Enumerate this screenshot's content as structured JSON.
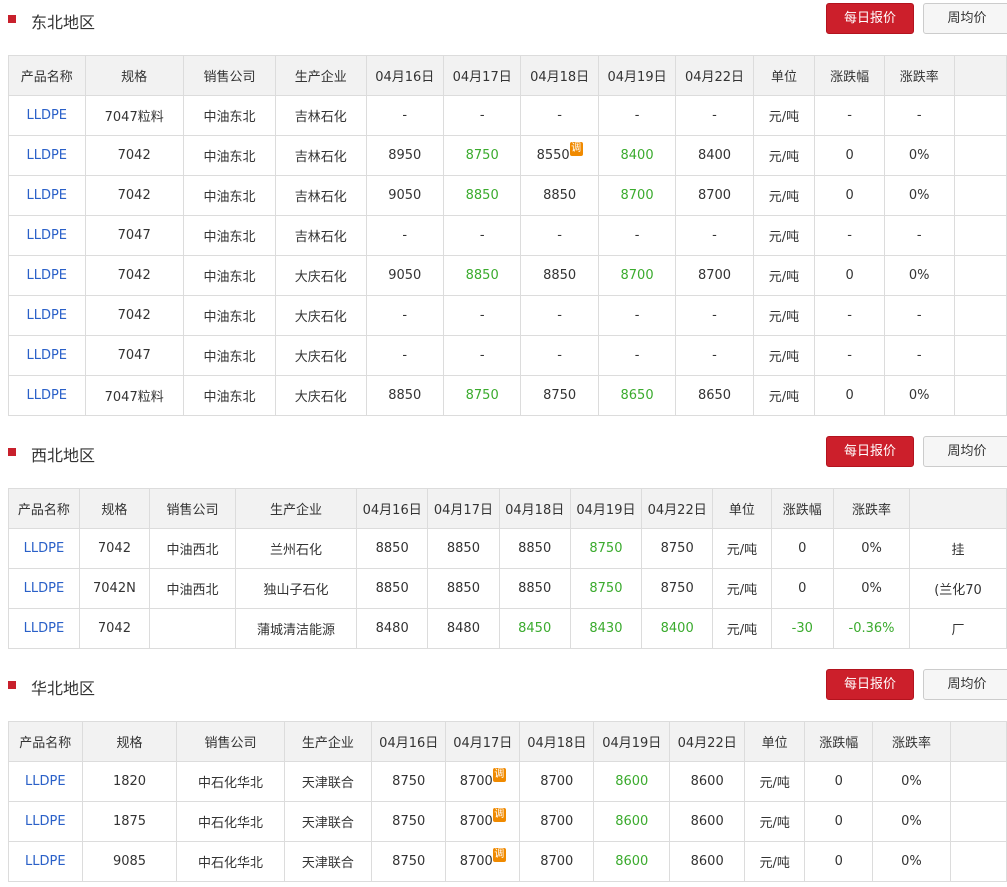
{
  "buttons": {
    "daily": "每日报价",
    "weekly": "周均价"
  },
  "adjust_badge": "调",
  "sections": [
    {
      "title": "东北地区",
      "headers": [
        "产品名称",
        "规格",
        "销售公司",
        "生产企业",
        "04月16日",
        "04月17日",
        "04月18日",
        "04月19日",
        "04月22日",
        "单位",
        "涨跌幅",
        "涨跌率",
        ""
      ],
      "rows": [
        [
          "LLDPE",
          "7047粒料",
          "中油东北",
          "吉林石化",
          "-",
          "-",
          "-",
          "-",
          "-",
          "元/吨",
          "-",
          "-",
          ""
        ],
        [
          "LLDPE",
          "7042",
          "中油东北",
          "吉林石化",
          "8950",
          "8750",
          "8550",
          "8400",
          "8400",
          "元/吨",
          "0",
          "0%",
          ""
        ],
        [
          "LLDPE",
          "7042",
          "中油东北",
          "吉林石化",
          "9050",
          "8850",
          "8850",
          "8700",
          "8700",
          "元/吨",
          "0",
          "0%",
          ""
        ],
        [
          "LLDPE",
          "7047",
          "中油东北",
          "吉林石化",
          "-",
          "-",
          "-",
          "-",
          "-",
          "元/吨",
          "-",
          "-",
          ""
        ],
        [
          "LLDPE",
          "7042",
          "中油东北",
          "大庆石化",
          "9050",
          "8850",
          "8850",
          "8700",
          "8700",
          "元/吨",
          "0",
          "0%",
          ""
        ],
        [
          "LLDPE",
          "7042",
          "中油东北",
          "大庆石化",
          "-",
          "-",
          "-",
          "-",
          "-",
          "元/吨",
          "-",
          "-",
          ""
        ],
        [
          "LLDPE",
          "7047",
          "中油东北",
          "大庆石化",
          "-",
          "-",
          "-",
          "-",
          "-",
          "元/吨",
          "-",
          "-",
          ""
        ],
        [
          "LLDPE",
          "7047粒料",
          "中油东北",
          "大庆石化",
          "8850",
          "8750",
          "8750",
          "8650",
          "8650",
          "元/吨",
          "0",
          "0%",
          ""
        ]
      ],
      "green": [
        [
          1,
          5
        ],
        [
          1,
          7
        ],
        [
          2,
          5
        ],
        [
          2,
          7
        ],
        [
          4,
          5
        ],
        [
          4,
          7
        ],
        [
          7,
          5
        ],
        [
          7,
          7
        ]
      ],
      "adj": [
        [
          1,
          6
        ]
      ]
    },
    {
      "title": "西北地区",
      "headers": [
        "产品名称",
        "规格",
        "销售公司",
        "生产企业",
        "04月16日",
        "04月17日",
        "04月18日",
        "04月19日",
        "04月22日",
        "单位",
        "涨跌幅",
        "涨跌率",
        ""
      ],
      "rows": [
        [
          "LLDPE",
          "7042",
          "中油西北",
          "兰州石化",
          "8850",
          "8850",
          "8850",
          "8750",
          "8750",
          "元/吨",
          "0",
          "0%",
          "挂"
        ],
        [
          "LLDPE",
          "7042N",
          "中油西北",
          "独山子石化",
          "8850",
          "8850",
          "8850",
          "8750",
          "8750",
          "元/吨",
          "0",
          "0%",
          "(兰化70"
        ],
        [
          "LLDPE",
          "7042",
          "",
          "蒲城清洁能源",
          "8480",
          "8480",
          "8450",
          "8430",
          "8400",
          "元/吨",
          "-30",
          "-0.36%",
          "厂"
        ]
      ],
      "green": [
        [
          0,
          7
        ],
        [
          1,
          7
        ],
        [
          2,
          6
        ],
        [
          2,
          7
        ],
        [
          2,
          8
        ],
        [
          2,
          10
        ],
        [
          2,
          11
        ]
      ],
      "adj": []
    },
    {
      "title": "华北地区",
      "headers": [
        "产品名称",
        "规格",
        "销售公司",
        "生产企业",
        "04月16日",
        "04月17日",
        "04月18日",
        "04月19日",
        "04月22日",
        "单位",
        "涨跌幅",
        "涨跌率",
        ""
      ],
      "rows": [
        [
          "LLDPE",
          "1820",
          "中石化华北",
          "天津联合",
          "8750",
          "8700",
          "8700",
          "8600",
          "8600",
          "元/吨",
          "0",
          "0%",
          ""
        ],
        [
          "LLDPE",
          "1875",
          "中石化华北",
          "天津联合",
          "8750",
          "8700",
          "8700",
          "8600",
          "8600",
          "元/吨",
          "0",
          "0%",
          ""
        ],
        [
          "LLDPE",
          "9085",
          "中石化华北",
          "天津联合",
          "8750",
          "8700",
          "8700",
          "8600",
          "8600",
          "元/吨",
          "0",
          "0%",
          ""
        ]
      ],
      "green": [
        [
          0,
          7
        ],
        [
          1,
          7
        ],
        [
          2,
          7
        ]
      ],
      "adj": [
        [
          0,
          5
        ],
        [
          1,
          5
        ],
        [
          2,
          5
        ]
      ]
    }
  ],
  "colors": {
    "accent_red": "#cc1f2b",
    "link_blue": "#2a60c8",
    "down_green": "#3bab2e",
    "adjust_orange": "#f08a00"
  }
}
